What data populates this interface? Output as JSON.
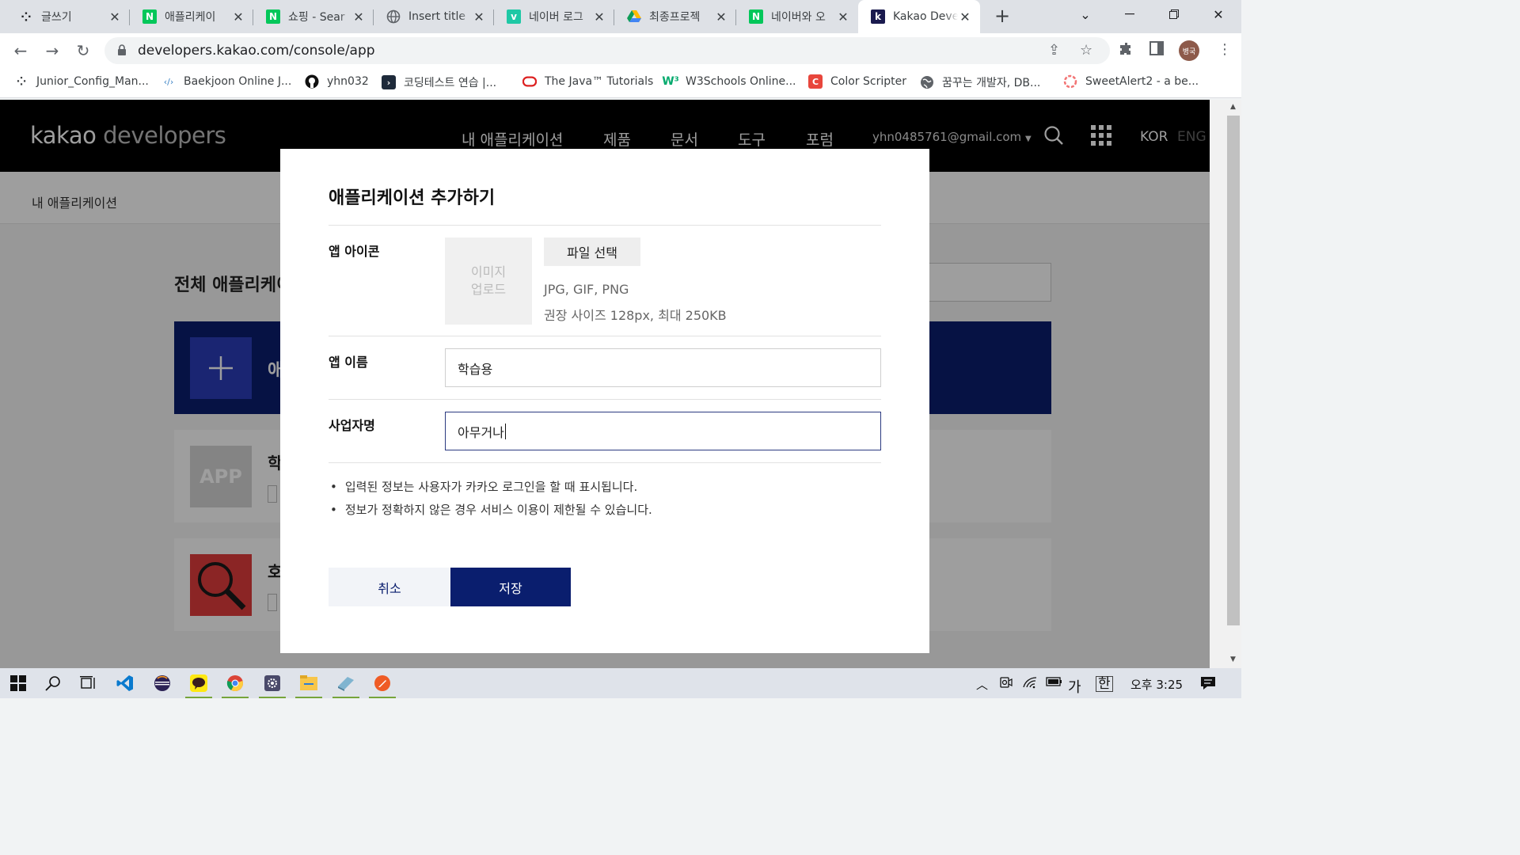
{
  "browser": {
    "tabs": [
      {
        "title": "글쓰기",
        "icon": "dots-icon",
        "color": "#202124"
      },
      {
        "title": "애플리케이",
        "icon": "naver-icon",
        "color": "#03c75a"
      },
      {
        "title": "쇼핑 - Sear",
        "icon": "naver-icon",
        "color": "#03c75a"
      },
      {
        "title": "Insert title",
        "icon": "globe-icon",
        "color": "#5f6368"
      },
      {
        "title": "네이버 로그",
        "icon": "v-icon",
        "color": "#1ec8a5"
      },
      {
        "title": "최종프로젝"
      },
      {
        "title": "네이버와 오",
        "icon": "naver-icon",
        "color": "#03c75a"
      },
      {
        "title": "Kakao Deve",
        "icon": "kakao-k-icon",
        "color": "#1a1a4e"
      }
    ],
    "address": "developers.kakao.com/console/app",
    "profile_label": "병국",
    "bookmarks": [
      {
        "label": "Junior_Config_Man..."
      },
      {
        "label": "Baekjoon Online J..."
      },
      {
        "label": "yhn032"
      },
      {
        "label": "코딩테스트 연습 |..."
      },
      {
        "label": "The Java™ Tutorials"
      },
      {
        "label": "W3Schools Online..."
      },
      {
        "label": "Color Scripter"
      },
      {
        "label": "꿈꾸는 개발자, DB..."
      },
      {
        "label": "SweetAlert2 - a be..."
      }
    ]
  },
  "site": {
    "logo_main": "kakao",
    "logo_sub": "developers",
    "nav": [
      "내 애플리케이션",
      "제품",
      "문서",
      "도구",
      "포럼"
    ],
    "email": "yhn0485761@gmail.com",
    "lang_active": "KOR",
    "lang_inactive": "ENG",
    "breadcrumb": "내 애플리케이션",
    "section_title": "전체 애플리케이션",
    "add_card_text": "애",
    "app1_icon_text": "APP",
    "app1_name": "학",
    "app2_name": "호"
  },
  "modal": {
    "title": "애플리케이션 추가하기",
    "icon_label": "앱 아이콘",
    "upload_line1": "이미지",
    "upload_line2": "업로드",
    "file_button": "파일 선택",
    "hint_formats": "JPG, GIF, PNG",
    "hint_size": "권장 사이즈 128px, 최대 250KB",
    "name_label": "앱 이름",
    "name_value": "학습용",
    "company_label": "사업자명",
    "company_value": "아무거나",
    "notes": [
      "입력된 정보는 사용자가 카카오 로그인을 할 때 표시됩니다.",
      "정보가 정확하지 않은 경우 서비스 이용이 제한될 수 있습니다."
    ],
    "cancel_label": "취소",
    "save_label": "저장"
  },
  "taskbar": {
    "ime_mode": "가",
    "ime_lang": "한",
    "time": "오후 3:25"
  }
}
